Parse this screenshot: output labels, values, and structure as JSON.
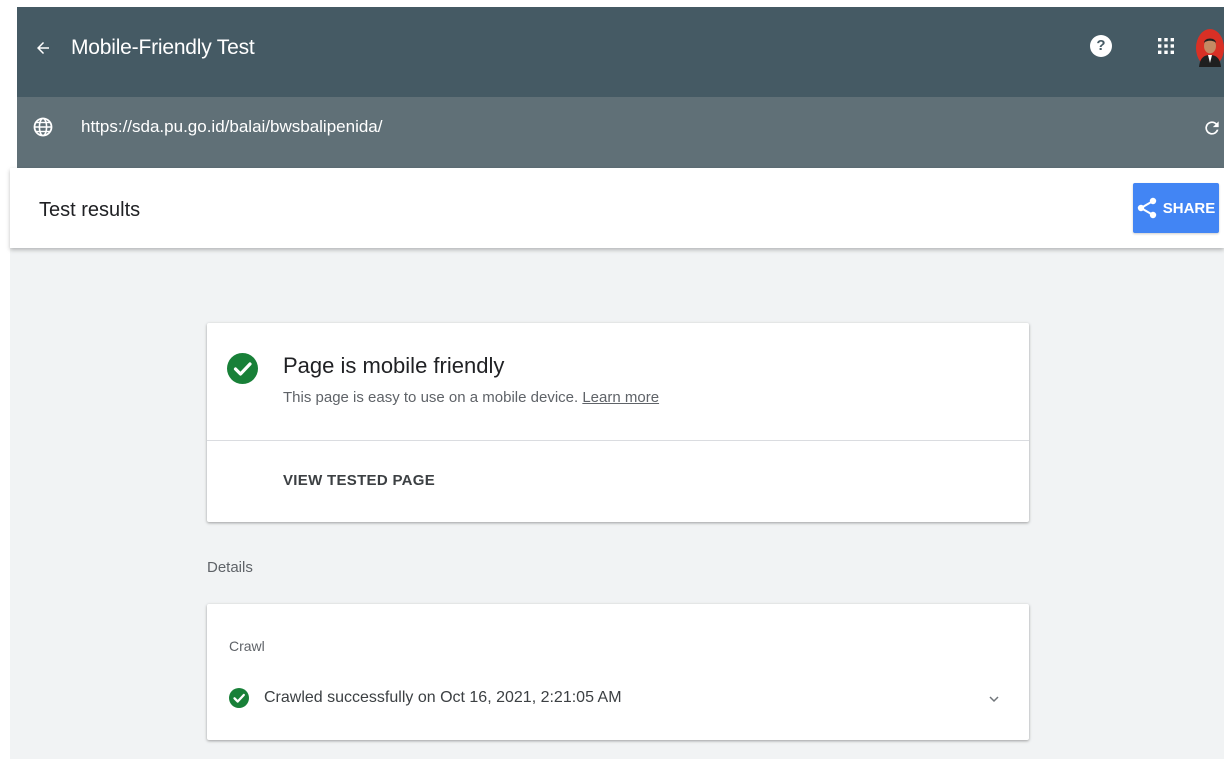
{
  "appbar": {
    "title": "Mobile-Friendly Test",
    "back_icon": "arrow-back-icon",
    "help_label": "?",
    "apps_icon": "apps-grid-icon",
    "avatar_icon": "user-avatar"
  },
  "urlbar": {
    "url": "https://sda.pu.go.id/balai/bwsbalipenida/",
    "globe_icon": "globe-icon",
    "reload_icon": "reload-icon"
  },
  "results": {
    "heading": "Test results",
    "share_label": "SHARE",
    "share_icon": "share-icon"
  },
  "summary": {
    "headline": "Page is mobile friendly",
    "description": "This page is easy to use on a mobile device.",
    "learn_more": "Learn more",
    "view_tested_page": "VIEW TESTED PAGE"
  },
  "details": {
    "label": "Details",
    "crawl": {
      "label": "Crawl",
      "status": "Crawled successfully on Oct 16, 2021, 2:21:05 AM",
      "expand_icon": "chevron-down-icon"
    }
  },
  "colors": {
    "appbar": "#455a64",
    "urlbar": "#607077",
    "accent_blue": "#4285f4",
    "success_green": "#188038",
    "content_bg": "#f1f3f4"
  }
}
